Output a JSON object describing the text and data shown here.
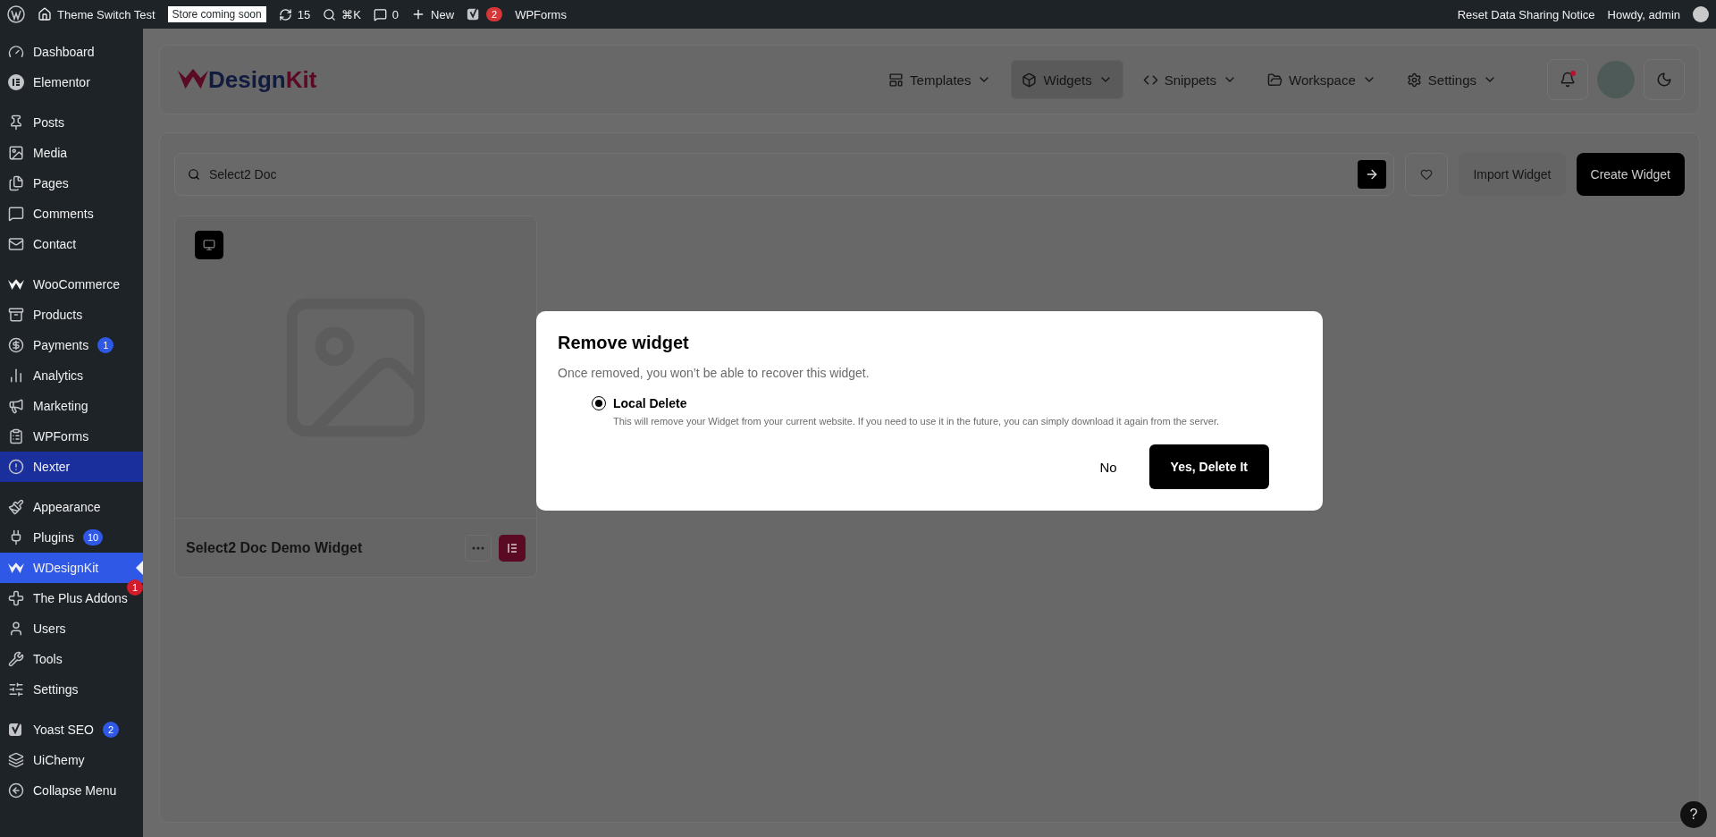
{
  "admin_bar": {
    "site": "Theme Switch Test",
    "store_badge": "Store coming soon",
    "updates": "15",
    "search_shortcut": "⌘K",
    "comments": "0",
    "new": "New",
    "yoast_count": "2",
    "wpforms": "WPForms",
    "reset_notice": "Reset Data Sharing Notice",
    "greeting": "Howdy, admin"
  },
  "sidebar": {
    "groups": [
      {
        "items": [
          {
            "label": "Dashboard",
            "selected": false,
            "hovered": false
          },
          {
            "label": "Elementor",
            "selected": false,
            "hovered": false
          }
        ]
      },
      {
        "items": [
          {
            "label": "Posts",
            "selected": false,
            "hovered": false
          },
          {
            "label": "Media",
            "selected": false,
            "hovered": false
          },
          {
            "label": "Pages",
            "selected": false,
            "hovered": false
          },
          {
            "label": "Comments",
            "selected": false,
            "hovered": false
          },
          {
            "label": "Contact",
            "selected": false,
            "hovered": false
          }
        ]
      },
      {
        "items": [
          {
            "label": "WooCommerce",
            "selected": false,
            "hovered": false
          },
          {
            "label": "Products",
            "selected": false,
            "hovered": false
          },
          {
            "label": "Payments",
            "selected": false,
            "hovered": false,
            "badge": {
              "text": "1",
              "color": "#2f58e6"
            }
          },
          {
            "label": "Analytics",
            "selected": false,
            "hovered": false
          },
          {
            "label": "Marketing",
            "selected": false,
            "hovered": false
          },
          {
            "label": "WPForms",
            "selected": false,
            "hovered": false
          },
          {
            "label": "Nexter",
            "selected": false,
            "hovered": true
          }
        ]
      },
      {
        "items": [
          {
            "label": "Appearance",
            "selected": false,
            "hovered": false
          },
          {
            "label": "Plugins",
            "selected": false,
            "hovered": false,
            "badge": {
              "text": "10",
              "color": "#2f58e6"
            }
          },
          {
            "label": "WDesignKit",
            "selected": true,
            "hovered": false
          },
          {
            "label": "The Plus Addons",
            "selected": false,
            "hovered": false,
            "badge": {
              "text": "1",
              "color": "#d21c2a"
            }
          },
          {
            "label": "Users",
            "selected": false,
            "hovered": false
          },
          {
            "label": "Tools",
            "selected": false,
            "hovered": false
          },
          {
            "label": "Settings",
            "selected": false,
            "hovered": false
          }
        ]
      },
      {
        "items": [
          {
            "label": "Yoast SEO",
            "selected": false,
            "hovered": false,
            "badge": {
              "text": "2",
              "color": "#2f58e6"
            }
          },
          {
            "label": "UiChemy",
            "selected": false,
            "hovered": false
          },
          {
            "label": "Collapse Menu",
            "selected": false,
            "hovered": false
          }
        ]
      }
    ]
  },
  "header": {
    "logo": {
      "text": "Design",
      "accent": "Kit"
    },
    "nav": [
      {
        "label": "Templates",
        "selected": false
      },
      {
        "label": "Widgets",
        "selected": true
      },
      {
        "label": "Snippets",
        "selected": false
      },
      {
        "label": "Workspace",
        "selected": false
      },
      {
        "label": "Settings",
        "selected": false
      }
    ],
    "notifications_unread": true
  },
  "toolbar": {
    "search": {
      "value": "Select2 Doc"
    },
    "import_button": "Import Widget",
    "create_button": "Create Widget"
  },
  "widgets": [
    {
      "title": "Select2 Doc Demo Widget"
    }
  ],
  "dialog": {
    "title": "Remove widget",
    "message": "Once removed, you won’t be able to recover this widget.",
    "options": [
      {
        "label": "Local Delete",
        "description": "This will remove your Widget from your current website. If you need to use it in the future, you can simply download it again from the server.",
        "selected": true
      }
    ],
    "cancel": "No",
    "confirm": "Yes, Delete It"
  },
  "help": "?"
}
